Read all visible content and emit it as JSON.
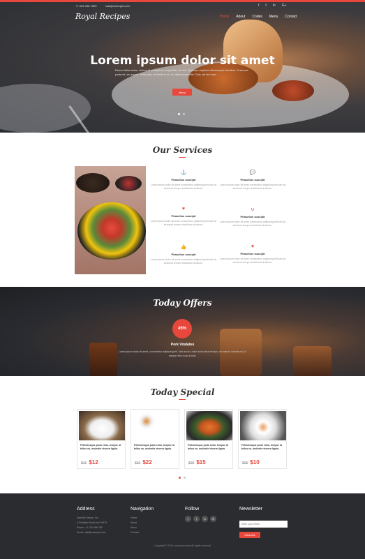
{
  "topbar": {
    "phone": "+1 523-456-7890",
    "email": "mail@example.com",
    "socials": [
      "f",
      "t",
      "in",
      "G+"
    ]
  },
  "header": {
    "logo": "Royal Recipes",
    "menu": [
      "Home",
      "About",
      "Codes",
      "Menu",
      "Contact"
    ]
  },
  "hero": {
    "title": "Lorem ipsum dolor sit amet",
    "text": "Donec tellus dolor, viverra id suscipit ac, imperdiet vel nisl. Quisque dapibus ullamcorper faucibus. Cras sed porta mi, ac augue. Nulla quis molestie eros, at ullamcorper nisl. Duis vel dui nunc.",
    "button": "Menu"
  },
  "services": {
    "title": "Our Services",
    "items": [
      {
        "icon": "anchor-icon",
        "glyph": "⚓",
        "title": "Phasellus suscipit",
        "text": "Lorem ipsum dolor sit amet consectetur adipiscing elit sed do eiusmod tempor incididunt ut labore."
      },
      {
        "icon": "chat-icon",
        "glyph": "💬",
        "title": "Phasellus suscipit",
        "text": "Lorem ipsum dolor sit amet consectetur adipiscing elit sed do eiusmod tempor incididunt ut labore."
      },
      {
        "icon": "heart-icon",
        "glyph": "♥",
        "title": "Phasellus suscipit",
        "text": "Lorem ipsum dolor sit amet consectetur adipiscing elit sed do eiusmod tempor incididunt ut labore."
      },
      {
        "icon": "magnet-icon",
        "glyph": "∪",
        "title": "Phasellus suscipit",
        "text": "Lorem ipsum dolor sit amet consectetur adipiscing elit sed do eiusmod tempor incididunt ut labore."
      },
      {
        "icon": "thumbs-up-icon",
        "glyph": "👍",
        "title": "Phasellus suscipit",
        "text": "Lorem ipsum dolor sit amet consectetur adipiscing elit sed do eiusmod tempor incididunt ut labore."
      },
      {
        "icon": "heartbeat-icon",
        "glyph": "♥",
        "title": "Phasellus suscipit",
        "text": "Lorem ipsum dolor sit amet consectetur adipiscing elit sed do eiusmod tempor incididunt ut labore."
      }
    ]
  },
  "offers": {
    "title": "Today Offers",
    "badge": "45%",
    "name": "Pork Vindaloo",
    "text": "Lorem ipsum dolor sit amet, consectetur adipiscing elit. Sed auctor, dolor at faucibus tempor, dui mauris lobortis nisl, id semper felis nunc at erat."
  },
  "special": {
    "title": "Today Special",
    "items": [
      {
        "desc": "Pellentesque justo enim, tempor id tellus eu, molestie viverra ligula.",
        "old": "$16",
        "new": "$12"
      },
      {
        "desc": "Pellentesque justo enim, tempor id tellus eu, molestie viverra ligula.",
        "old": "$33",
        "new": "$22"
      },
      {
        "desc": "Pellentesque justo enim, tempor id tellus eu, molestie viverra ligula.",
        "old": "$20",
        "new": "$15"
      },
      {
        "desc": "Pellentesque justo enim, tempor id tellus eu, molestie viverra ligula.",
        "old": "$25",
        "new": "$10"
      }
    ]
  },
  "footer": {
    "address": {
      "title": "Address",
      "lines": [
        "Imperial Tampa, Inc.",
        "9 Sheffield Road Ave 34975",
        "Phone: +1 123 456 789",
        "Email: mail@example.com"
      ]
    },
    "navigation": {
      "title": "Navigation",
      "links": [
        "Home",
        "About",
        "Menu",
        "Contact"
      ]
    },
    "follow": {
      "title": "Follow",
      "icons": [
        "f",
        "t",
        "in",
        "✉"
      ]
    },
    "newsletter": {
      "title": "Newsletter",
      "placeholder": "Enter your email",
      "button": "Subscribe"
    },
    "copyright": "Copyright © 2016 company name All rights reserved"
  },
  "colors": {
    "accent": "#e8473b",
    "footer": "#2b2c30"
  }
}
